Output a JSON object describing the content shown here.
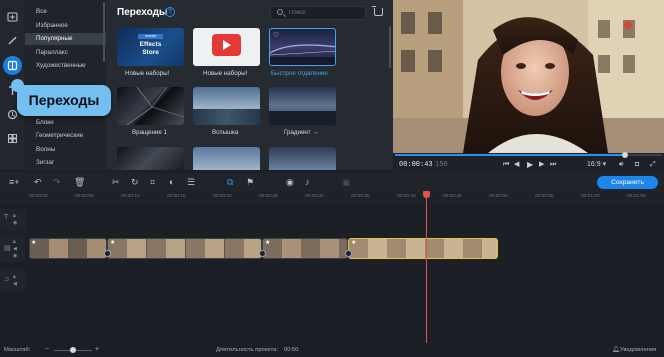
{
  "rail": {
    "tools": [
      "import-icon",
      "magic-wand-icon",
      "transitions-icon",
      "titles-icon",
      "stickers-icon",
      "more-icon"
    ]
  },
  "categories": [
    "Все",
    "Избранное",
    "Популярные",
    "Параллакс",
    "Художественные",
    "Блоки",
    "Геометрические",
    "Волны",
    "Зигзаг"
  ],
  "panel": {
    "title": "Переходы",
    "search_placeholder": "Поиск",
    "tiles": [
      {
        "label": "Новые наборы!",
        "text": "Effects Store",
        "badge": "movavi"
      },
      {
        "label": "Новые наборы!"
      },
      {
        "label": "Быстрое отдаление"
      },
      {
        "label": "Вращение 1"
      },
      {
        "label": "Вспышка"
      },
      {
        "label": "Градиент →"
      },
      {
        "label": ""
      },
      {
        "label": ""
      },
      {
        "label": ""
      }
    ]
  },
  "player": {
    "timecode": "00:00:43",
    "frame": "150",
    "aspect": "16:9",
    "progress": 0.86
  },
  "toolbar": {
    "save_label": "Сохранить"
  },
  "timeline": {
    "ruler": [
      "00:00:00",
      "00:00:05",
      "00:00:10",
      "00:00:15",
      "00:00:20",
      "00:00:25",
      "00:00:30",
      "00:00:35",
      "00:00:40",
      "00:00:45",
      "00:00:50",
      "00:00:55",
      "00:01:00",
      "00:01:05"
    ]
  },
  "callout": {
    "text": "Переходы"
  },
  "status": {
    "scale_label": "Масштаб:",
    "duration_label": "Длительность проекта:",
    "duration": "00:50",
    "notifications": "Уведомления"
  },
  "colors": {
    "accent": "#1e86ea",
    "callout": "#72bff0",
    "selected_clip": "#e4c443",
    "playhead": "#e05050"
  }
}
